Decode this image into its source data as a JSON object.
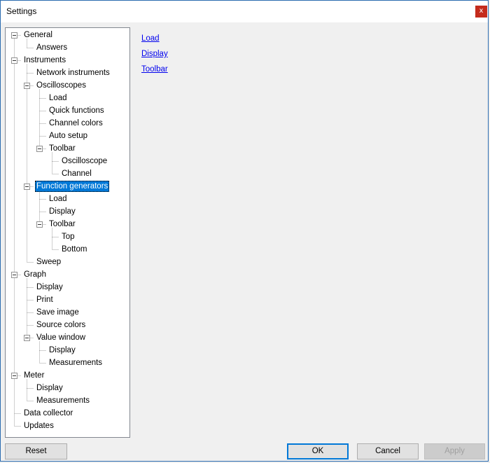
{
  "window": {
    "title": "Settings",
    "close_glyph": "x"
  },
  "tree": {
    "selected": "Function generators",
    "nodes": [
      {
        "label": "General",
        "depth": 0,
        "expander": true
      },
      {
        "label": "Answers",
        "depth": 1
      },
      {
        "label": "Instruments",
        "depth": 0,
        "expander": true
      },
      {
        "label": "Network instruments",
        "depth": 1
      },
      {
        "label": "Oscilloscopes",
        "depth": 1,
        "expander": true
      },
      {
        "label": "Load",
        "depth": 2
      },
      {
        "label": "Quick functions",
        "depth": 2
      },
      {
        "label": "Channel colors",
        "depth": 2
      },
      {
        "label": "Auto setup",
        "depth": 2
      },
      {
        "label": "Toolbar",
        "depth": 2,
        "expander": true
      },
      {
        "label": "Oscilloscope",
        "depth": 3
      },
      {
        "label": "Channel",
        "depth": 3
      },
      {
        "label": "Function generators",
        "depth": 1,
        "expander": true,
        "selected": true
      },
      {
        "label": "Load",
        "depth": 2
      },
      {
        "label": "Display",
        "depth": 2
      },
      {
        "label": "Toolbar",
        "depth": 2,
        "expander": true
      },
      {
        "label": "Top",
        "depth": 3
      },
      {
        "label": "Bottom",
        "depth": 3
      },
      {
        "label": "Sweep",
        "depth": 1
      },
      {
        "label": "Graph",
        "depth": 0,
        "expander": true
      },
      {
        "label": "Display",
        "depth": 1
      },
      {
        "label": "Print",
        "depth": 1
      },
      {
        "label": "Save image",
        "depth": 1
      },
      {
        "label": "Source colors",
        "depth": 1
      },
      {
        "label": "Value window",
        "depth": 1,
        "expander": true
      },
      {
        "label": "Display",
        "depth": 2
      },
      {
        "label": "Measurements",
        "depth": 2
      },
      {
        "label": "Meter",
        "depth": 0,
        "expander": true
      },
      {
        "label": "Display",
        "depth": 1
      },
      {
        "label": "Measurements",
        "depth": 1
      },
      {
        "label": "Data collector",
        "depth": 0
      },
      {
        "label": "Updates",
        "depth": 0
      }
    ]
  },
  "links": [
    "Load",
    "Display",
    "Toolbar"
  ],
  "buttons": {
    "reset": "Reset",
    "ok": "OK",
    "cancel": "Cancel",
    "apply": "Apply"
  },
  "colors": {
    "selection": "#0078d7",
    "close": "#c42b1c",
    "link": "#0000ee"
  }
}
